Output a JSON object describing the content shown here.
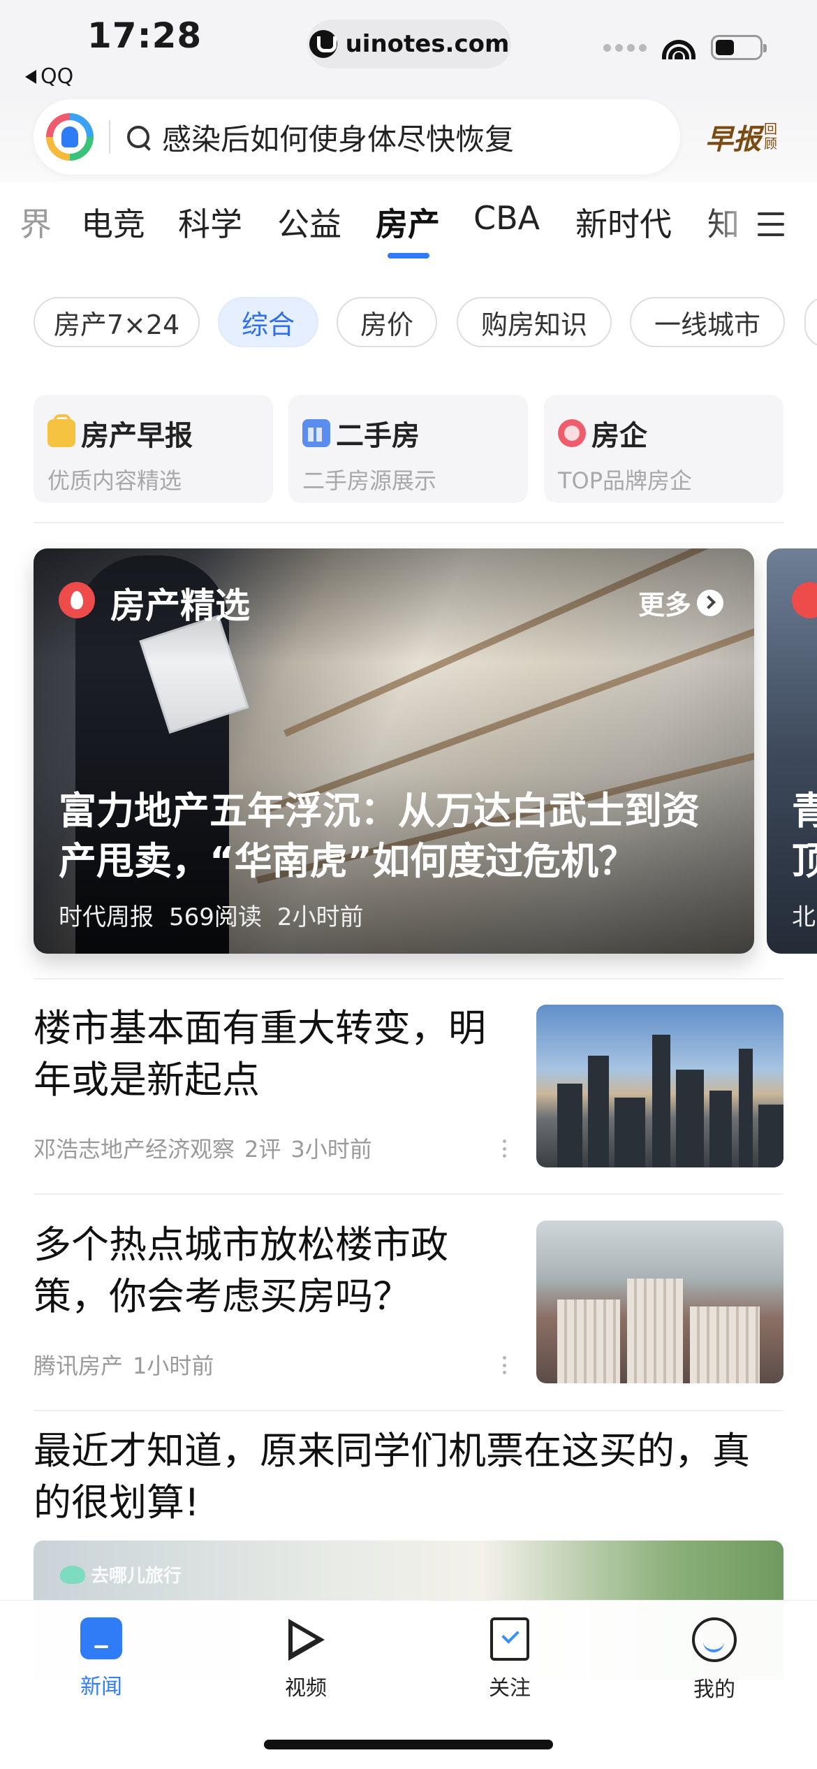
{
  "status_bar": {
    "time": "17:28",
    "back_app": "QQ",
    "url": "uinotes.com"
  },
  "search": {
    "query": "感染后如何使身体尽快恢复",
    "brief_label": "早报",
    "brief_sub": "回顾"
  },
  "channels": {
    "items": [
      "界",
      "电竞",
      "科学",
      "公益",
      "房产",
      "CBA",
      "新时代",
      "知"
    ],
    "active": "房产"
  },
  "chips": [
    "房产7×24",
    "综合",
    "房价",
    "购房知识",
    "一线城市"
  ],
  "quick_cards": [
    {
      "title": "房产早报",
      "subtitle": "优质内容精选",
      "icon": "bag-icon"
    },
    {
      "title": "二手房",
      "subtitle": "二手房源展示",
      "icon": "house-icon"
    },
    {
      "title": "房企",
      "subtitle": "TOP品牌房企",
      "icon": "ring-icon"
    }
  ],
  "featured": {
    "section_label": "房产精选",
    "more_label": "更多",
    "title": "富力地产五年浮沉：从万达白武士到资产甩卖，“华南虎”如何度过危机？",
    "source": "时代周报",
    "reads": "569阅读",
    "time": "2小时前",
    "next_title": "青顶",
    "next_meta": "北"
  },
  "articles": [
    {
      "title": "楼市基本面有重大转变，明年或是新起点",
      "source": "邓浩志地产经济观察",
      "comments": "2评",
      "time": "3小时前"
    },
    {
      "title": "多个热点城市放松楼市政策，你会考虑买房吗？",
      "source": "腾讯房产",
      "time": "1小时前"
    }
  ],
  "ad": {
    "title": "最近才知道，原来同学们机票在这买的，真的很划算!",
    "brand": "去哪儿旅行"
  },
  "bottom_nav": [
    {
      "label": "新闻",
      "icon": "news-icon"
    },
    {
      "label": "视频",
      "icon": "video-icon"
    },
    {
      "label": "关注",
      "icon": "follow-icon"
    },
    {
      "label": "我的",
      "icon": "profile-icon"
    }
  ],
  "colors": {
    "accent": "#2f7cf6",
    "chip_active_bg": "#e6efff",
    "hot_red": "#ee4b4b"
  }
}
